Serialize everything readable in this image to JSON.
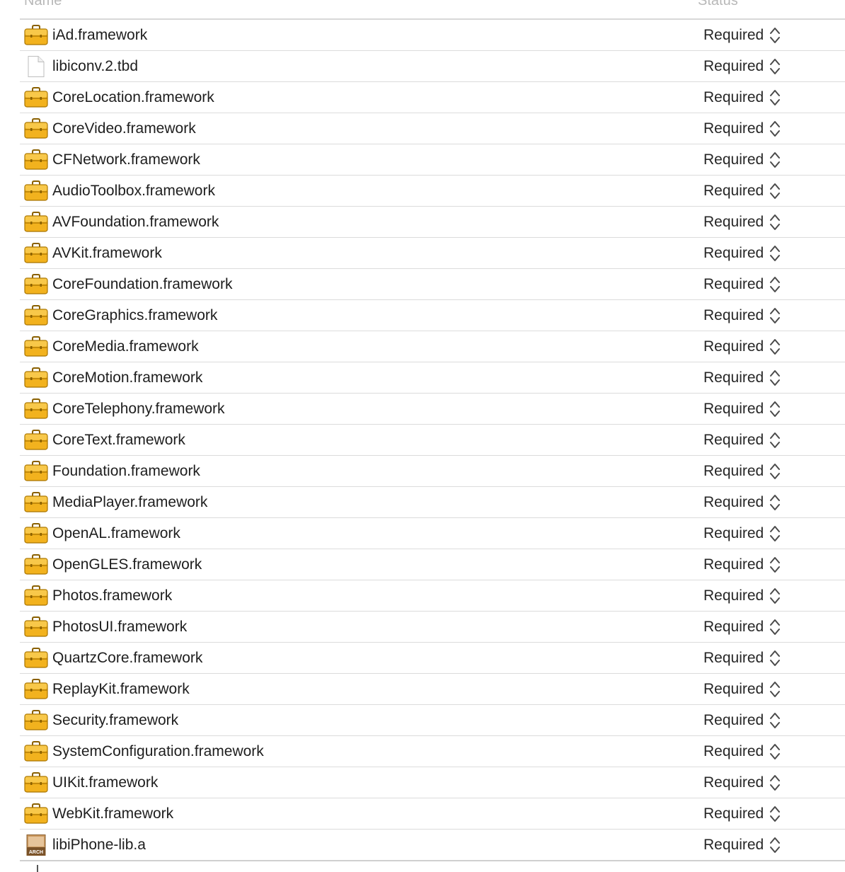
{
  "header": {
    "name_label": "Name",
    "status_label": "Status"
  },
  "colors": {
    "briefcase_body": "#f2b21e",
    "briefcase_dark": "#a87400",
    "separator": "#dcdcdc",
    "text": "#1e1e1e"
  },
  "files": [
    {
      "name": "iAd.framework",
      "icon": "framework-icon",
      "status": "Required"
    },
    {
      "name": "libiconv.2.tbd",
      "icon": "document-icon",
      "status": "Required"
    },
    {
      "name": "CoreLocation.framework",
      "icon": "framework-icon",
      "status": "Required"
    },
    {
      "name": "CoreVideo.framework",
      "icon": "framework-icon",
      "status": "Required"
    },
    {
      "name": "CFNetwork.framework",
      "icon": "framework-icon",
      "status": "Required"
    },
    {
      "name": "AudioToolbox.framework",
      "icon": "framework-icon",
      "status": "Required"
    },
    {
      "name": "AVFoundation.framework",
      "icon": "framework-icon",
      "status": "Required"
    },
    {
      "name": "AVKit.framework",
      "icon": "framework-icon",
      "status": "Required"
    },
    {
      "name": "CoreFoundation.framework",
      "icon": "framework-icon",
      "status": "Required"
    },
    {
      "name": "CoreGraphics.framework",
      "icon": "framework-icon",
      "status": "Required"
    },
    {
      "name": "CoreMedia.framework",
      "icon": "framework-icon",
      "status": "Required"
    },
    {
      "name": "CoreMotion.framework",
      "icon": "framework-icon",
      "status": "Required"
    },
    {
      "name": "CoreTelephony.framework",
      "icon": "framework-icon",
      "status": "Required"
    },
    {
      "name": "CoreText.framework",
      "icon": "framework-icon",
      "status": "Required"
    },
    {
      "name": "Foundation.framework",
      "icon": "framework-icon",
      "status": "Required"
    },
    {
      "name": "MediaPlayer.framework",
      "icon": "framework-icon",
      "status": "Required"
    },
    {
      "name": "OpenAL.framework",
      "icon": "framework-icon",
      "status": "Required"
    },
    {
      "name": "OpenGLES.framework",
      "icon": "framework-icon",
      "status": "Required"
    },
    {
      "name": "Photos.framework",
      "icon": "framework-icon",
      "status": "Required"
    },
    {
      "name": "PhotosUI.framework",
      "icon": "framework-icon",
      "status": "Required"
    },
    {
      "name": "QuartzCore.framework",
      "icon": "framework-icon",
      "status": "Required"
    },
    {
      "name": "ReplayKit.framework",
      "icon": "framework-icon",
      "status": "Required"
    },
    {
      "name": "Security.framework",
      "icon": "framework-icon",
      "status": "Required"
    },
    {
      "name": "SystemConfiguration.framework",
      "icon": "framework-icon",
      "status": "Required"
    },
    {
      "name": "UIKit.framework",
      "icon": "framework-icon",
      "status": "Required"
    },
    {
      "name": "WebKit.framework",
      "icon": "framework-icon",
      "status": "Required"
    },
    {
      "name": "libiPhone-lib.a",
      "icon": "archive-icon",
      "icon_text": "ARCH",
      "status": "Required"
    }
  ]
}
